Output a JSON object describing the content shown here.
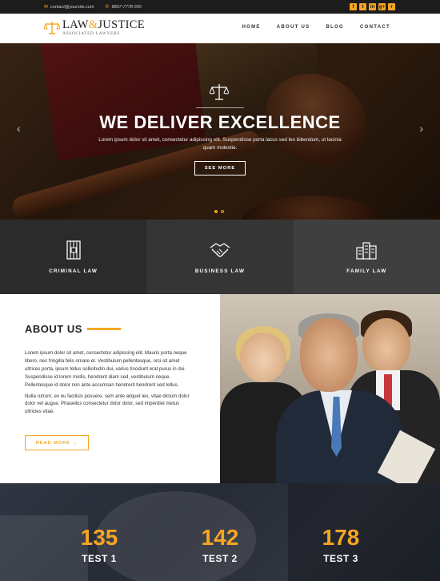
{
  "topbar": {
    "email": "contact@yoursite.com",
    "phone": "8897-7778 000",
    "email_icon": "envelope-icon",
    "phone_icon": "phone-icon",
    "socials": [
      {
        "icon": "facebook-icon",
        "glyph": "f"
      },
      {
        "icon": "twitter-icon",
        "glyph": "t"
      },
      {
        "icon": "linkedin-icon",
        "glyph": "in"
      },
      {
        "icon": "google-plus-icon",
        "glyph": "g+"
      },
      {
        "icon": "rss-icon",
        "glyph": "r"
      }
    ]
  },
  "header": {
    "brand_left": "LAW",
    "brand_amp": "&",
    "brand_right": "JUSTICE",
    "brand_sub": "ASSOCIATED LAWYERS",
    "nav": [
      "HOME",
      "ABOUT US",
      "BLOG",
      "CONTACT"
    ]
  },
  "hero": {
    "title": "WE DELIVER EXCELLENCE",
    "text": "Lorem ipsum dolor sit amet, consectetur adipiscing elit. Suspendisse porta lacus sed leo bibendum, ut lacinia quam molestie.",
    "cta": "SEE MORE",
    "prev": "‹",
    "next": "›"
  },
  "areas": [
    {
      "label": "CRIMINAL LAW",
      "icon": "prison-door-icon"
    },
    {
      "label": "BUSINESS LAW",
      "icon": "handshake-icon"
    },
    {
      "label": "FAMILY LAW",
      "icon": "buildings-icon"
    }
  ],
  "about": {
    "title": "ABOUT US",
    "para1": "Lorem ipsum dolor sit amet, consectetur adipiscing elit. Mauris porta neque libero, nec fringilla felis ornare et. Vestibulum pellentesque, orci sit amet ultrices porta, ipsum tellus sollicitudin dui, varius tincidunt erat purus in dui. Suspendisse id lorem mollis, hendrerit diam sed, vestibulum neque. Pellentesque id dolor non ante accumsan hendrerit hendrerit sed tellus.",
    "para2": "Nulla rutrum, ex eu facilisis posuere, sem ante aliquet leo, vitae dictum dolor dolor vel augue. Phasellus consectetur dolor dolor, sed imperdiet metus ultricies vitae.",
    "more": "READ MORE →"
  },
  "stats": [
    {
      "value": "135",
      "label": "TEST 1"
    },
    {
      "value": "142",
      "label": "TEST 2"
    },
    {
      "value": "178",
      "label": "TEST 3"
    }
  ],
  "colors": {
    "accent": "#f5a623",
    "dark": "#1c1c1c"
  }
}
